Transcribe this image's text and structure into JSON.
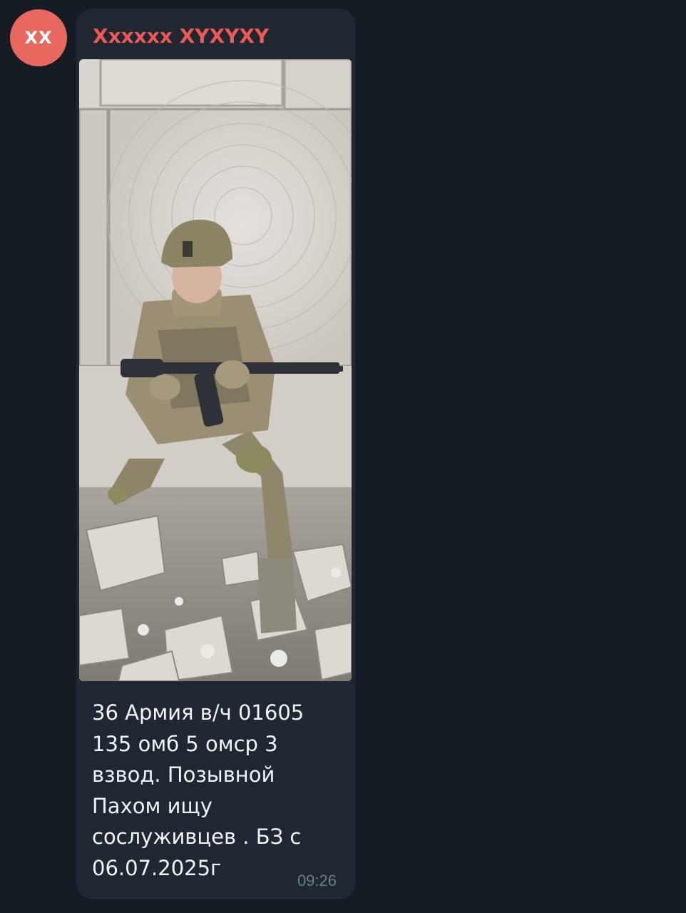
{
  "avatar": {
    "initials": "XX",
    "color": "#e8685f"
  },
  "message": {
    "sender": "Xxxxxx XYXYXY",
    "sender_color": "#ee5a53",
    "photo": {
      "description_icon": "photo-image"
    },
    "caption": "36 Армия в/ч 01605\n135 омб 5 омср 3\nвзвод. Позывной\nПахом ищу\nсослуживцев . БЗ с\n06.07.2025г",
    "time": "09:26"
  },
  "colors": {
    "background": "#151c24",
    "bubble": "#1e2732",
    "caption_text": "#f2f4f6",
    "time_text": "#6e7c89"
  }
}
